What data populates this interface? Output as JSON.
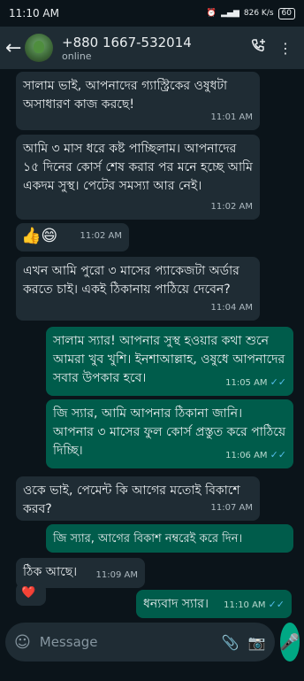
{
  "status": {
    "time": "11:10 AM",
    "data_rate": "826 K/s",
    "battery": "60"
  },
  "header": {
    "name": "+880 1667-532014",
    "status": "online"
  },
  "messages": [
    {
      "text": "সালাম ভাই, আপনাদের গ্যাস্ট্রিকের ওষুধটা অসাধারণ কাজ করছে!",
      "time": "11:01 AM"
    },
    {
      "text": "আমি ৩ মাস ধরে কষ্ট পাচ্ছিলাম। আপনাদের ১৫ দিনের কোর্স শেষ করার পর মনে হচ্ছে আমি একদম সুস্থ। পেটের সমস্যা আর নেই।",
      "time": "11:02 AM"
    },
    {
      "text": "👍😄",
      "time": "11:02 AM"
    },
    {
      "text": "এখন আমি পুরো ৩ মাসের প্যাকেজটা অর্ডার করতে চাই। একই ঠিকানায় পাঠিয়ে দেবেন?",
      "time": "11:04 AM"
    },
    {
      "text": "সালাম স্যার! আপনার সুস্থ হওয়ার কথা শুনে আমরা খুব খুশি। ইনশাআল্লাহ, ওষুধে আপনাদের সবার উপকার হবে।",
      "time": "11:05 AM"
    },
    {
      "text": "জি স্যার, আমি আপনার ঠিকানা জানি। আপনার ৩ মাসের ফুল কোর্স প্রস্তুত করে পাঠিয়ে দিচ্ছি।",
      "time": "11:06 AM"
    },
    {
      "text": "ওকে ভাই, পেমেন্ট কি আগের মতোই বিকাশে করব?",
      "time": "11:07 AM"
    },
    {
      "text": "জি স্যার, আগের বিকাশ নম্বরেই করে দিন।",
      "time": ""
    },
    {
      "text": "ঠিক আছে।",
      "time": "11:09 AM"
    },
    {
      "text": "❤️",
      "time": ""
    },
    {
      "text": "ধন্যবাদ স্যার।",
      "time": "11:10 AM"
    }
  ],
  "input": {
    "placeholder": "Message"
  },
  "icons": {
    "back": "arrow-left-icon",
    "add_call": "add-call-icon",
    "menu": "more-vert-icon",
    "emoji": "emoji-icon",
    "attach": "paperclip-icon",
    "camera": "camera-icon",
    "mic": "mic-icon",
    "read": "double-check-icon"
  },
  "colors": {
    "background": "#0b141a",
    "incoming": "#1f2c34",
    "outgoing": "#005c4b",
    "accent": "#00a884",
    "read_tick": "#53bdeb"
  }
}
